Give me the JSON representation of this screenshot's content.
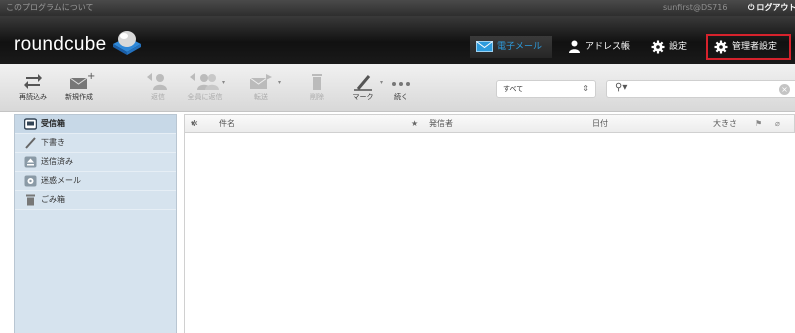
{
  "topbar": {
    "about_label": "このプログラムについて",
    "user": "sunfirst@DS716",
    "logout_label": "ログアウト"
  },
  "header": {
    "logo_text": "roundcube",
    "nav": {
      "mail": "電子メール",
      "addressbook": "アドレス帳",
      "settings": "設定",
      "admin_settings": "管理者設定"
    }
  },
  "toolbar": {
    "refresh": "再読込み",
    "compose": "新規作成",
    "reply": "返信",
    "reply_all": "全員に返信",
    "forward": "転送",
    "delete": "削除",
    "mark": "マーク",
    "more": "続く",
    "filter_value": "すべて"
  },
  "folders": [
    {
      "label": "受信箱",
      "icon": "inbox-icon",
      "selected": true
    },
    {
      "label": "下書き",
      "icon": "pencil-icon",
      "selected": false
    },
    {
      "label": "送信済み",
      "icon": "sent-icon",
      "selected": false
    },
    {
      "label": "迷惑メール",
      "icon": "junk-icon",
      "selected": false
    },
    {
      "label": "ごみ箱",
      "icon": "trash-icon",
      "selected": false
    }
  ],
  "list_columns": {
    "subject": "件名",
    "from": "発信者",
    "date": "日付",
    "size": "大きさ"
  },
  "colors": {
    "accent": "#2d9bdc",
    "highlight_border": "#d6222c",
    "sidebar_bg": "#d6e3ee"
  }
}
